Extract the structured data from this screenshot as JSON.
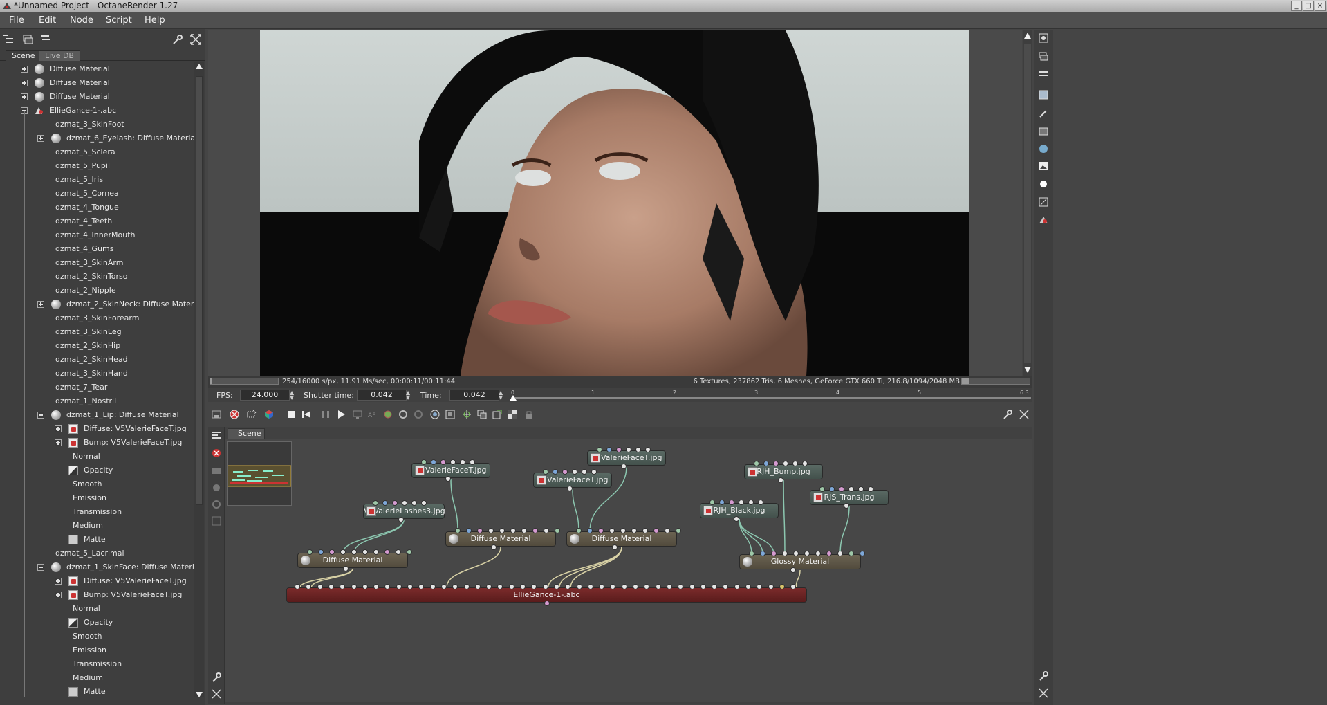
{
  "window": {
    "title": "*Unnamed Project - OctaneRender 1.27",
    "controls": [
      "_",
      "□",
      "×"
    ]
  },
  "menu": [
    "File",
    "Edit",
    "Node",
    "Script",
    "Help"
  ],
  "left_panel": {
    "tabs": [
      "Scene",
      "Live DB"
    ],
    "tree": [
      {
        "label": "Diffuse Material",
        "kind": "material",
        "expander": "plus",
        "depth": 0
      },
      {
        "label": "Diffuse Material",
        "kind": "material",
        "expander": "plus",
        "depth": 0
      },
      {
        "label": "Diffuse Material",
        "kind": "material",
        "expander": "plus",
        "depth": 0
      },
      {
        "label": "EllieGance-1-.abc",
        "kind": "mesh",
        "expander": "minus",
        "depth": 0
      },
      {
        "label": "dzmat_3_SkinFoot",
        "kind": "none",
        "expander": "",
        "depth": 1
      },
      {
        "label": "dzmat_6_Eyelash: Diffuse Material",
        "kind": "material",
        "expander": "plus",
        "depth": 1
      },
      {
        "label": "dzmat_5_Sclera",
        "kind": "none",
        "expander": "",
        "depth": 1
      },
      {
        "label": "dzmat_5_Pupil",
        "kind": "none",
        "expander": "",
        "depth": 1
      },
      {
        "label": "dzmat_5_Iris",
        "kind": "none",
        "expander": "",
        "depth": 1
      },
      {
        "label": "dzmat_5_Cornea",
        "kind": "none",
        "expander": "",
        "depth": 1
      },
      {
        "label": "dzmat_4_Tongue",
        "kind": "none",
        "expander": "",
        "depth": 1
      },
      {
        "label": "dzmat_4_Teeth",
        "kind": "none",
        "expander": "",
        "depth": 1
      },
      {
        "label": "dzmat_4_InnerMouth",
        "kind": "none",
        "expander": "",
        "depth": 1
      },
      {
        "label": "dzmat_4_Gums",
        "kind": "none",
        "expander": "",
        "depth": 1
      },
      {
        "label": "dzmat_3_SkinArm",
        "kind": "none",
        "expander": "",
        "depth": 1
      },
      {
        "label": "dzmat_2_SkinTorso",
        "kind": "none",
        "expander": "",
        "depth": 1
      },
      {
        "label": "dzmat_2_Nipple",
        "kind": "none",
        "expander": "",
        "depth": 1
      },
      {
        "label": "dzmat_2_SkinNeck: Diffuse Material",
        "kind": "material",
        "expander": "plus",
        "depth": 1
      },
      {
        "label": "dzmat_3_SkinForearm",
        "kind": "none",
        "expander": "",
        "depth": 1
      },
      {
        "label": "dzmat_3_SkinLeg",
        "kind": "none",
        "expander": "",
        "depth": 1
      },
      {
        "label": "dzmat_2_SkinHip",
        "kind": "none",
        "expander": "",
        "depth": 1
      },
      {
        "label": "dzmat_2_SkinHead",
        "kind": "none",
        "expander": "",
        "depth": 1
      },
      {
        "label": "dzmat_3_SkinHand",
        "kind": "none",
        "expander": "",
        "depth": 1
      },
      {
        "label": "dzmat_7_Tear",
        "kind": "none",
        "expander": "",
        "depth": 1
      },
      {
        "label": "dzmat_1_Nostril",
        "kind": "none",
        "expander": "",
        "depth": 1
      },
      {
        "label": "dzmat_1_Lip: Diffuse Material",
        "kind": "material",
        "expander": "minus",
        "depth": 1
      },
      {
        "label": "Diffuse: V5ValerieFaceT.jpg",
        "kind": "texture",
        "expander": "plus",
        "depth": 2
      },
      {
        "label": "Bump: V5ValerieFaceT.jpg",
        "kind": "texture",
        "expander": "plus",
        "depth": 2
      },
      {
        "label": "Normal",
        "kind": "none",
        "expander": "",
        "depth": 2
      },
      {
        "label": "Opacity",
        "kind": "opacity",
        "expander": "",
        "depth": 2
      },
      {
        "label": "Smooth",
        "kind": "none",
        "expander": "",
        "depth": 2
      },
      {
        "label": "Emission",
        "kind": "none",
        "expander": "",
        "depth": 2
      },
      {
        "label": "Transmission",
        "kind": "none",
        "expander": "",
        "depth": 2
      },
      {
        "label": "Medium",
        "kind": "none",
        "expander": "",
        "depth": 2
      },
      {
        "label": "Matte",
        "kind": "matte",
        "expander": "",
        "depth": 2
      },
      {
        "label": "dzmat_5_Lacrimal",
        "kind": "none",
        "expander": "",
        "depth": 1
      },
      {
        "label": "dzmat_1_SkinFace: Diffuse Material",
        "kind": "material",
        "expander": "minus",
        "depth": 1
      },
      {
        "label": "Diffuse: V5ValerieFaceT.jpg",
        "kind": "texture",
        "expander": "plus",
        "depth": 2
      },
      {
        "label": "Bump: V5ValerieFaceT.jpg",
        "kind": "texture",
        "expander": "plus",
        "depth": 2
      },
      {
        "label": "Normal",
        "kind": "none",
        "expander": "",
        "depth": 2
      },
      {
        "label": "Opacity",
        "kind": "opacity",
        "expander": "",
        "depth": 2
      },
      {
        "label": "Smooth",
        "kind": "none",
        "expander": "",
        "depth": 2
      },
      {
        "label": "Emission",
        "kind": "none",
        "expander": "",
        "depth": 2
      },
      {
        "label": "Transmission",
        "kind": "none",
        "expander": "",
        "depth": 2
      },
      {
        "label": "Medium",
        "kind": "none",
        "expander": "",
        "depth": 2
      },
      {
        "label": "Matte",
        "kind": "matte",
        "expander": "",
        "depth": 2
      }
    ]
  },
  "render_status": {
    "left": "254/16000 s/px, 11.91 Ms/sec, 00:00:11/00:11:44",
    "right": "6 Textures, 237862 Tris, 6 Meshes, GeForce GTX 660 Ti, 216.8/1094/2048 MB",
    "progress": 0.0159
  },
  "time_controls": {
    "fps_label": "FPS:",
    "fps_value": "24.000",
    "shutter_label": "Shutter time:",
    "shutter_value": "0.042",
    "time_label": "Time:",
    "time_value": "0.042",
    "ticks": [
      "0",
      "1",
      "2",
      "3",
      "4",
      "5",
      "6.3"
    ]
  },
  "node_graph": {
    "tab": "Scene",
    "nodes": [
      {
        "id": "tex1",
        "label": "V5ValerieFaceT.jpg",
        "kind": "tex"
      },
      {
        "id": "tex2",
        "label": "V5ValerieFaceT.jpg",
        "kind": "tex"
      },
      {
        "id": "tex3",
        "label": "V5ValerieFaceT.jpg",
        "kind": "tex"
      },
      {
        "id": "tex4",
        "label": "V5ValerieLashes3.jpg",
        "kind": "tex"
      },
      {
        "id": "tex5",
        "label": "RJH_Bump.jpg",
        "kind": "tex"
      },
      {
        "id": "tex6",
        "label": "RJS_Trans.jpg",
        "kind": "tex"
      },
      {
        "id": "tex7",
        "label": "RJH_Black.jpg",
        "kind": "tex"
      },
      {
        "id": "mat1",
        "label": "Diffuse Material",
        "kind": "mat"
      },
      {
        "id": "mat2",
        "label": "Diffuse Material",
        "kind": "mat"
      },
      {
        "id": "mat3",
        "label": "Diffuse Material",
        "kind": "mat"
      },
      {
        "id": "mat4",
        "label": "Glossy Material",
        "kind": "mat"
      },
      {
        "id": "mesh",
        "label": "EllieGance-1-.abc",
        "kind": "mesh"
      }
    ]
  }
}
